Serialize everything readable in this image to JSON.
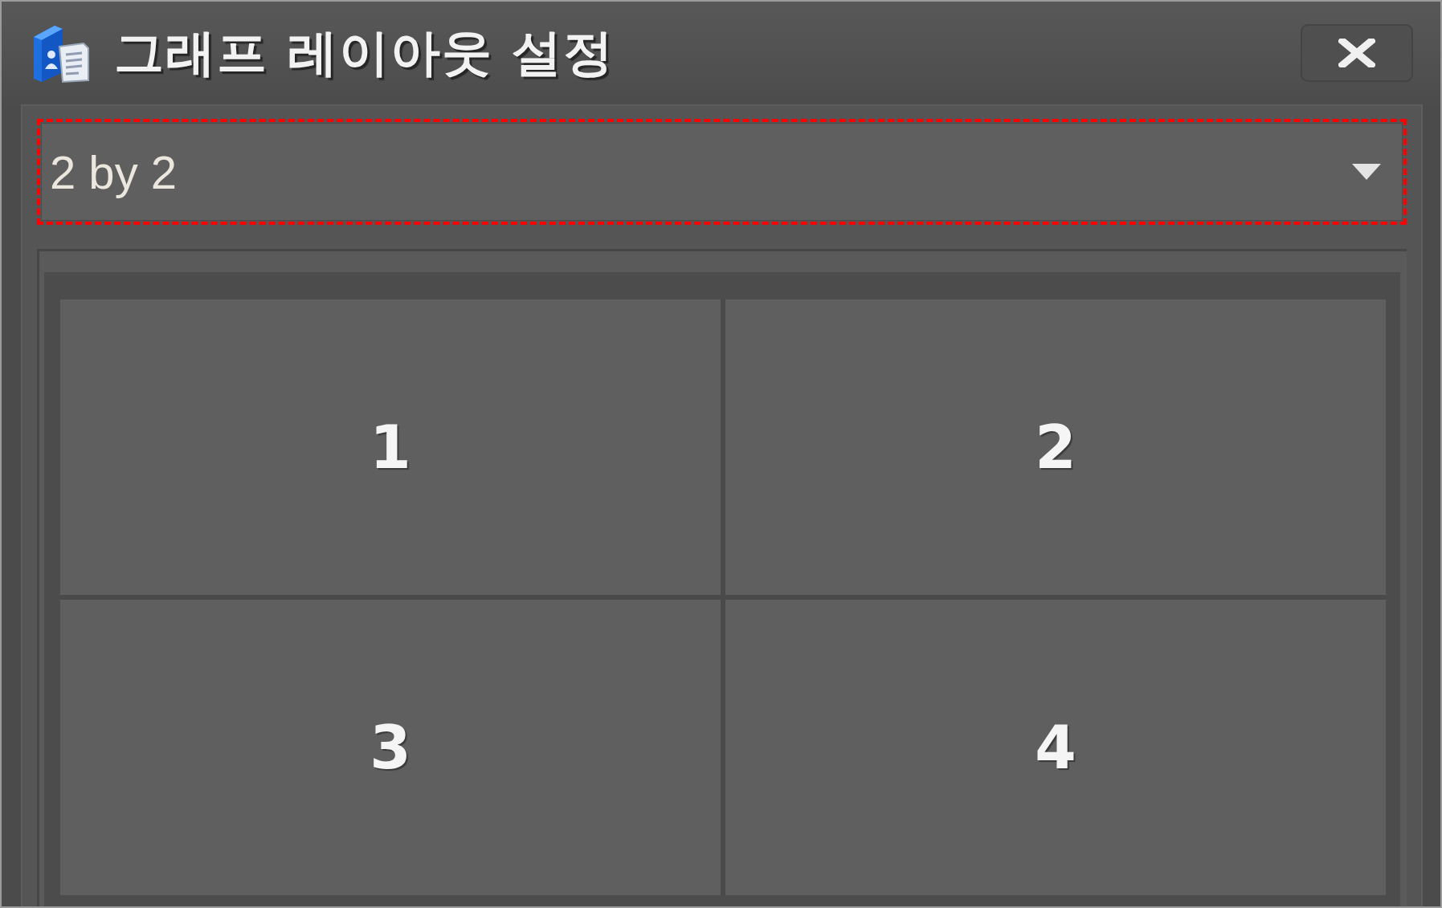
{
  "window": {
    "title": "그래프 레이아웃 설정"
  },
  "layout_select": {
    "value": "2 by 2",
    "highlighted": true
  },
  "panes": [
    {
      "label": "1"
    },
    {
      "label": "2"
    },
    {
      "label": "3"
    },
    {
      "label": "4"
    }
  ]
}
